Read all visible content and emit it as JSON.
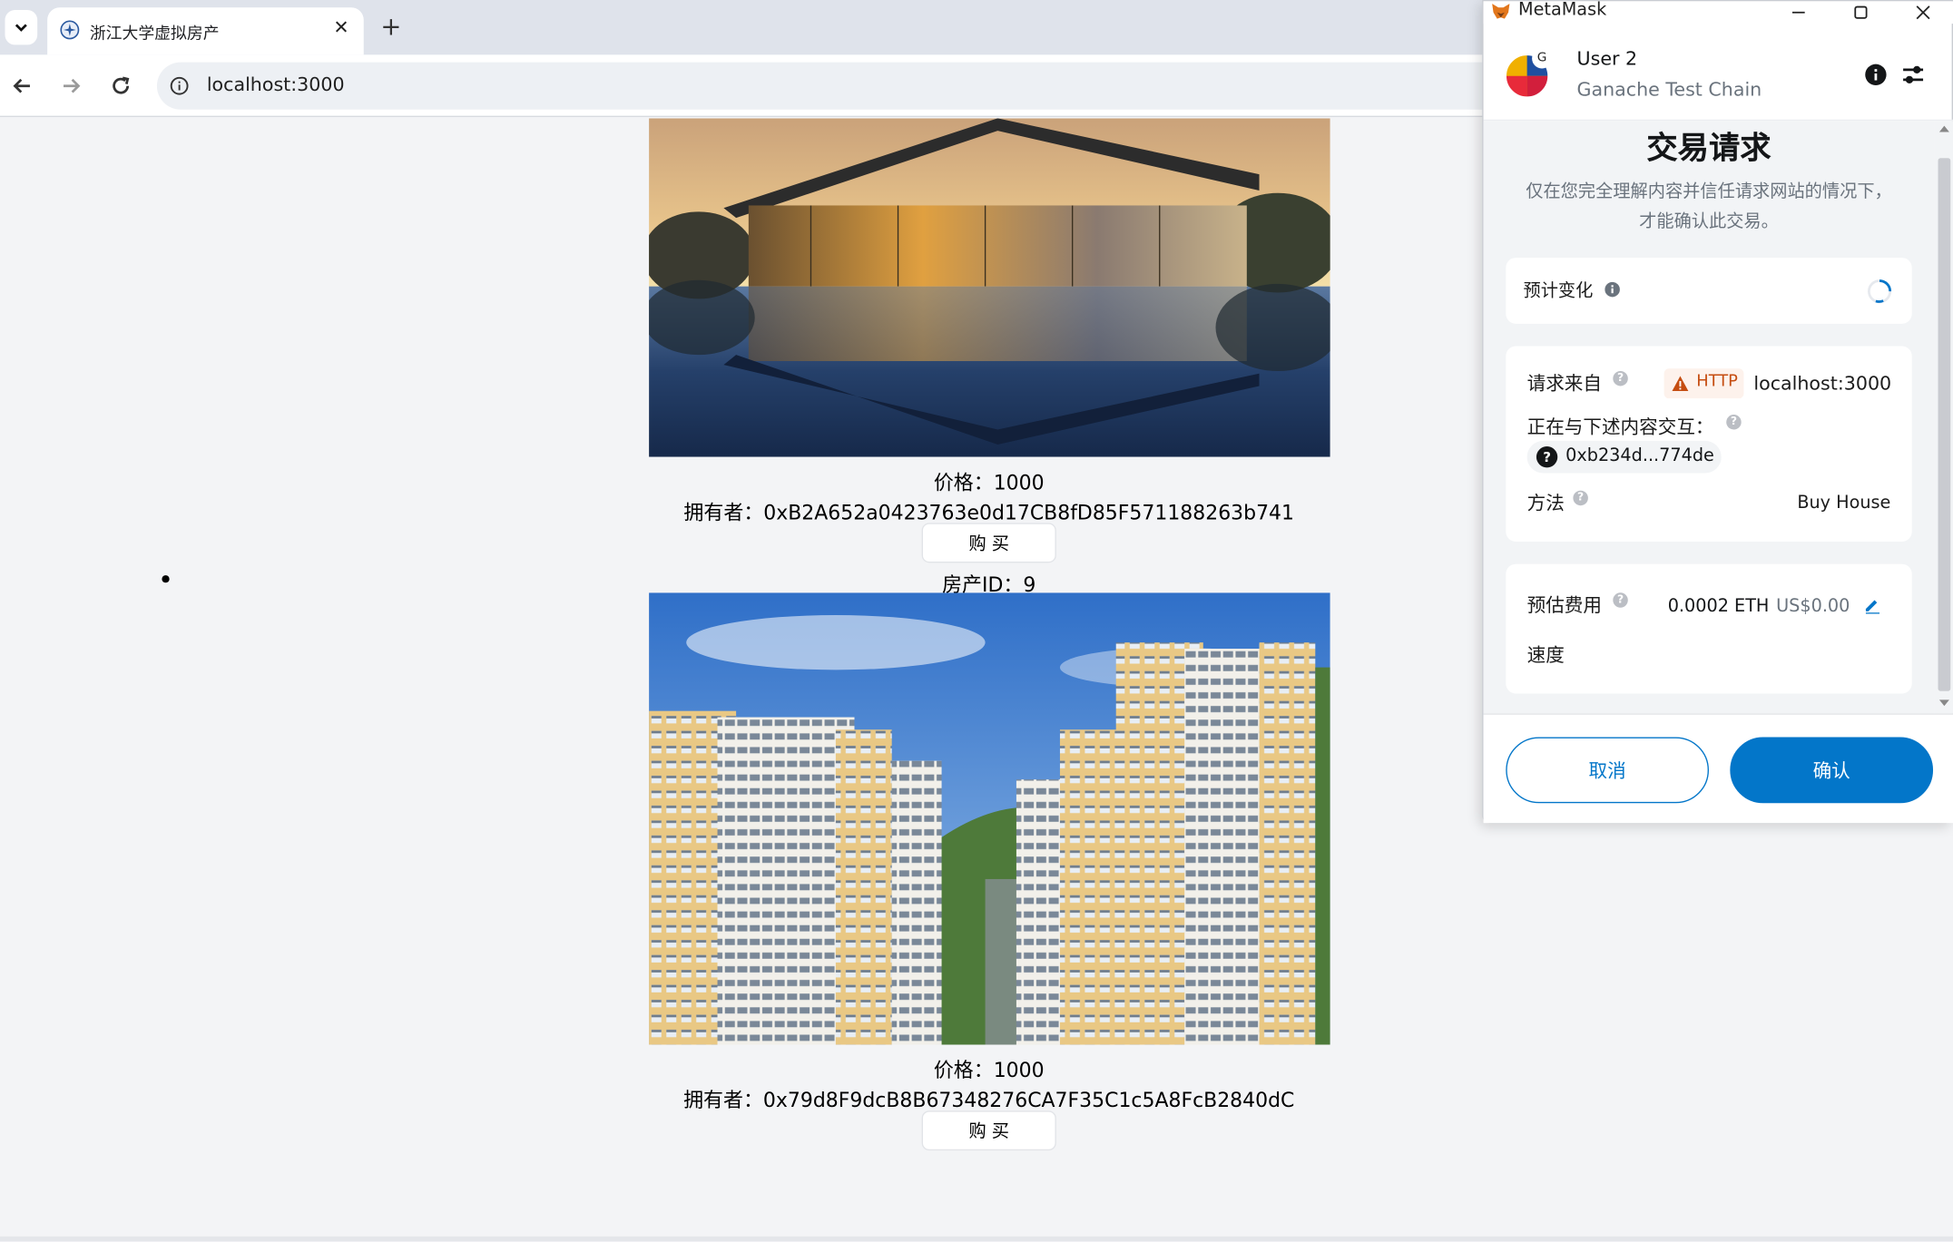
{
  "browser": {
    "tab_title": "浙江大学虚拟房产",
    "tab_close": "✕",
    "new_tab": "+",
    "url": "localhost:3000"
  },
  "listings": [
    {
      "price_label": "价格：1000",
      "owner_label": "拥有者：0xB2A652a0423763e0d17CB8fD85F571188263b741",
      "buy_label": "购 买"
    },
    {
      "id_label": "房产ID：9",
      "price_label": "价格：1000",
      "owner_label": "拥有者：0x79d8F9dcB8B67348276CA7F35C1c5A8FcB2840dC",
      "buy_label": "购 买"
    }
  ],
  "metamask": {
    "window_title": "MetaMask",
    "account_name": "User 2",
    "network_name": "Ganache Test Chain",
    "avatar_badge": "G",
    "heading": "交易请求",
    "subtitle_line1": "仅在您完全理解内容并信任请求网站的情况下，",
    "subtitle_line2": "才能确认此交易。",
    "estimated_changes_label": "预计变化",
    "request_from_label": "请求来自",
    "http_badge": "HTTP",
    "origin": "localhost:3000",
    "interacting_label": "正在与下述内容交互：",
    "contract_address": "0xb234d...774de",
    "method_label": "方法",
    "method_value": "Buy House",
    "fee_label": "预估费用",
    "fee_eth": "0.0002 ETH",
    "fee_usd": "US$0.00",
    "speed_label": "速度",
    "cancel_label": "取消",
    "confirm_label": "确认",
    "colors": {
      "primary": "#0376c9",
      "warning": "#c54d11"
    }
  }
}
